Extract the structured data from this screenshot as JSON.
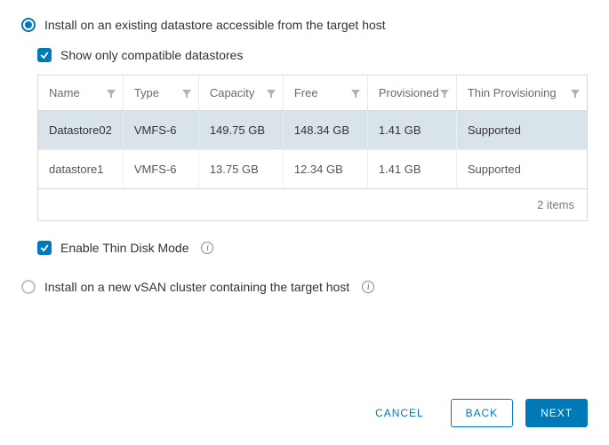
{
  "options": {
    "existing_label": "Install on an existing datastore accessible from the target host",
    "compat_label": "Show only compatible datastores",
    "thin_label": "Enable Thin Disk Mode",
    "vsan_label": "Install on a new vSAN cluster containing the target host"
  },
  "table": {
    "headers": {
      "name": "Name",
      "type": "Type",
      "capacity": "Capacity",
      "free": "Free",
      "provisioned": "Provisioned",
      "thin": "Thin Provisioning"
    },
    "rows": [
      {
        "name": "Datastore02",
        "type": "VMFS-6",
        "capacity": "149.75 GB",
        "free": "148.34 GB",
        "provisioned": "1.41 GB",
        "thin": "Supported"
      },
      {
        "name": "datastore1",
        "type": "VMFS-6",
        "capacity": "13.75 GB",
        "free": "12.34 GB",
        "provisioned": "1.41 GB",
        "thin": "Supported"
      }
    ],
    "footer": "2  items"
  },
  "buttons": {
    "cancel": "CANCEL",
    "back": "BACK",
    "next": "NEXT"
  }
}
